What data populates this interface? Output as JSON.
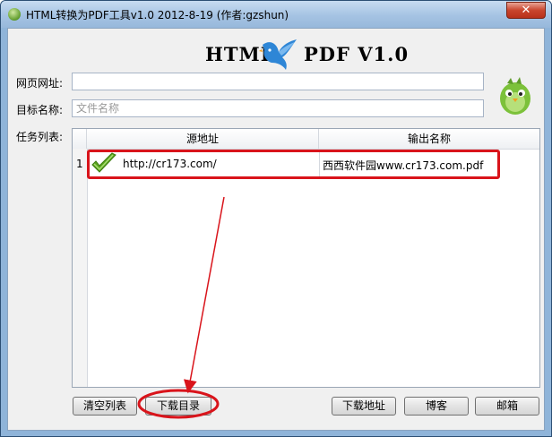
{
  "window": {
    "title": "HTML转换为PDF工具v1.0 2012-8-19 (作者:gzshun)",
    "close_glyph": "✕"
  },
  "banner": {
    "left_text": "HTML",
    "right_text": "PDF V1.0"
  },
  "form": {
    "url_label": "网页网址:",
    "url_value": "",
    "name_label": "目标名称:",
    "name_placeholder": "文件名称",
    "tasks_label": "任务列表:"
  },
  "table": {
    "columns": [
      "源地址",
      "输出名称"
    ],
    "rows": [
      {
        "num": "1",
        "source": "http://cr173.com/",
        "output": "西西软件园www.cr173.com.pdf",
        "status_icon": "check-icon"
      }
    ]
  },
  "buttons": {
    "clear": "清空列表",
    "catalog": "下载目录",
    "address": "下载地址",
    "blog": "博客",
    "mail": "邮箱"
  },
  "colors": {
    "annotation": "#d9141b",
    "check": "#5aa51e",
    "bird": "#2e86d6",
    "mascot": "#7cc13a"
  }
}
